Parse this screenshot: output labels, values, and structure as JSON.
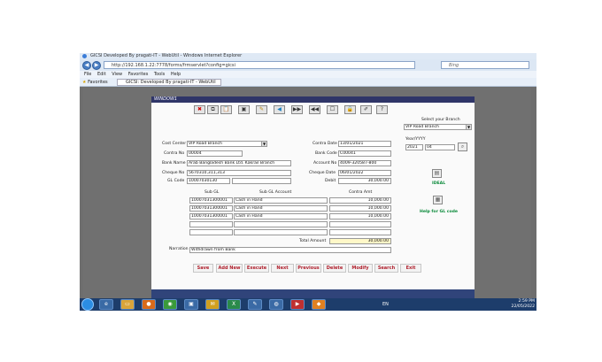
{
  "browser": {
    "title": "GICSI Developed By pragati-IT - WebUtil - Windows Internet Explorer",
    "url": "http://192.168.1.22:7778/forms/frmservlet?config=gicsi",
    "search_placeholder": "Bing",
    "menu": [
      "File",
      "Edit",
      "View",
      "Favorites",
      "Tools",
      "Help"
    ],
    "favorites_label": "Favorites",
    "tab_title": "GICSI: Developed By pragati-IT - WebUtil"
  },
  "app": {
    "header_title": "WINDOW1",
    "toolbar_icons": [
      "close-x-icon",
      "copy-icon",
      "paste-icon",
      "save-icon",
      "folder-icon",
      "arrow-left-icon",
      "next-icon",
      "prev-icon",
      "doc-icon",
      "lock-icon",
      "edit-icon",
      "help-icon"
    ],
    "toolbar_glyphs": [
      "✖",
      "⧉",
      "📋",
      "▣",
      "✎",
      "◀",
      "▶▶",
      "◀◀",
      "☐",
      "🔒",
      "✐",
      "?"
    ],
    "branch": {
      "label": "Select your Branch",
      "value": "VIP Road Branch"
    },
    "year_month": {
      "label": "Year/YYYY",
      "year": "2021",
      "month": "04"
    },
    "ideal_label": "IDEAL",
    "help_gl_label": "Help for GL code",
    "form": {
      "cost_center_label": "Cost Center",
      "cost_center_value": "VIP Road Branch",
      "contra_no_label": "Contra No",
      "contra_no_value": "00004",
      "bank_name_label": "Bank Name",
      "bank_name_value": "Arab Bangladesh Bank Ltd. Kakrail Branch",
      "cheque_no_label": "Cheque No",
      "cheque_no_value": "5670310,311,313",
      "gl_code_label": "GL Code",
      "gl_code_value": "10007030130",
      "contra_date_label": "Contra Date",
      "contra_date_value": "13/01/2021",
      "bank_code_label": "Bank Code",
      "bank_code_value": "C00041",
      "account_no_label": "Account No",
      "account_no_value": "4009-320587-800",
      "cheque_date_label": "Cheque Date",
      "cheque_date_value": "06/01/2022",
      "debit_label": "Debit",
      "debit_value": "30,000.00"
    },
    "grid": {
      "headers": [
        "Sub GL",
        "Sub GL Account",
        "Contra Amt"
      ],
      "rows": [
        {
          "sub_gl": "10007031300001",
          "account": "Cash in Hand",
          "amount": "10,000.00"
        },
        {
          "sub_gl": "10007031300001",
          "account": "Cash in Hand",
          "amount": "10,000.00"
        },
        {
          "sub_gl": "10007031300001",
          "account": "Cash in Hand",
          "amount": "10,000.00"
        },
        {
          "sub_gl": "",
          "account": "",
          "amount": ""
        },
        {
          "sub_gl": "",
          "account": "",
          "amount": ""
        }
      ],
      "total_label": "Total Amount",
      "total_value": "30,000.00"
    },
    "narration_label": "Narration",
    "narration_value": "Withdrawn from Bank",
    "buttons": [
      "Save",
      "Add New",
      "Execute",
      "Next",
      "Previous",
      "Delete",
      "Modify",
      "Search",
      "Exit"
    ]
  },
  "taskbar": {
    "time": "2:59 PM",
    "date": "22/05/2022",
    "lang": "EN"
  }
}
